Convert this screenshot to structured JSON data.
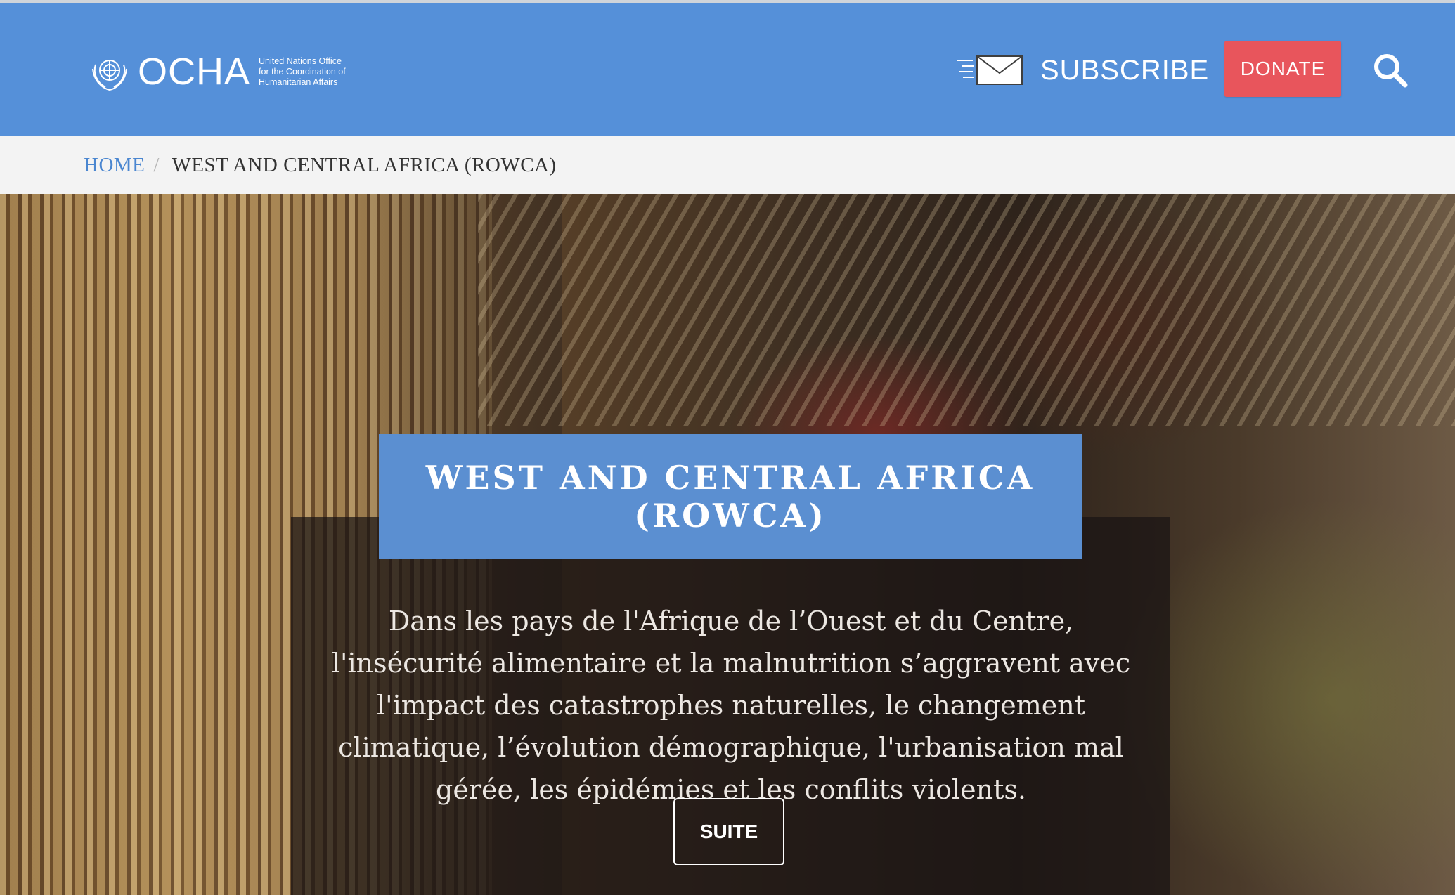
{
  "header": {
    "logo": {
      "name": "OCHA",
      "subtitle_lines": [
        "United Nations Office",
        "for the Coordination of",
        "Humanitarian  Affairs"
      ]
    },
    "subscribe_label": "SUBSCRIBE",
    "donate_label": "DONATE",
    "icons": {
      "logo": "un-emblem-icon",
      "subscribe": "envelope-icon",
      "search": "search-icon"
    },
    "colors": {
      "header_bg": "#5590d9",
      "donate_bg": "#e8555c",
      "title_box_bg": "#5b8fd1"
    }
  },
  "breadcrumb": {
    "home": "HOME",
    "separator": "/",
    "current": "WEST AND CENTRAL AFRICA (ROWCA)"
  },
  "hero": {
    "title_lines": [
      "WEST AND CENTRAL AFRICA",
      "(ROWCA)"
    ],
    "body": "Dans les pays de l'Afrique de l’Ouest et du Centre, l'insécurité alimentaire et la malnutrition s’aggravent avec l'impact des catastrophes naturelles, le changement climatique, l’évolution démographique, l'urbanisation mal gérée, les épidémies et les conflits violents.",
    "button_label": "SUITE"
  }
}
